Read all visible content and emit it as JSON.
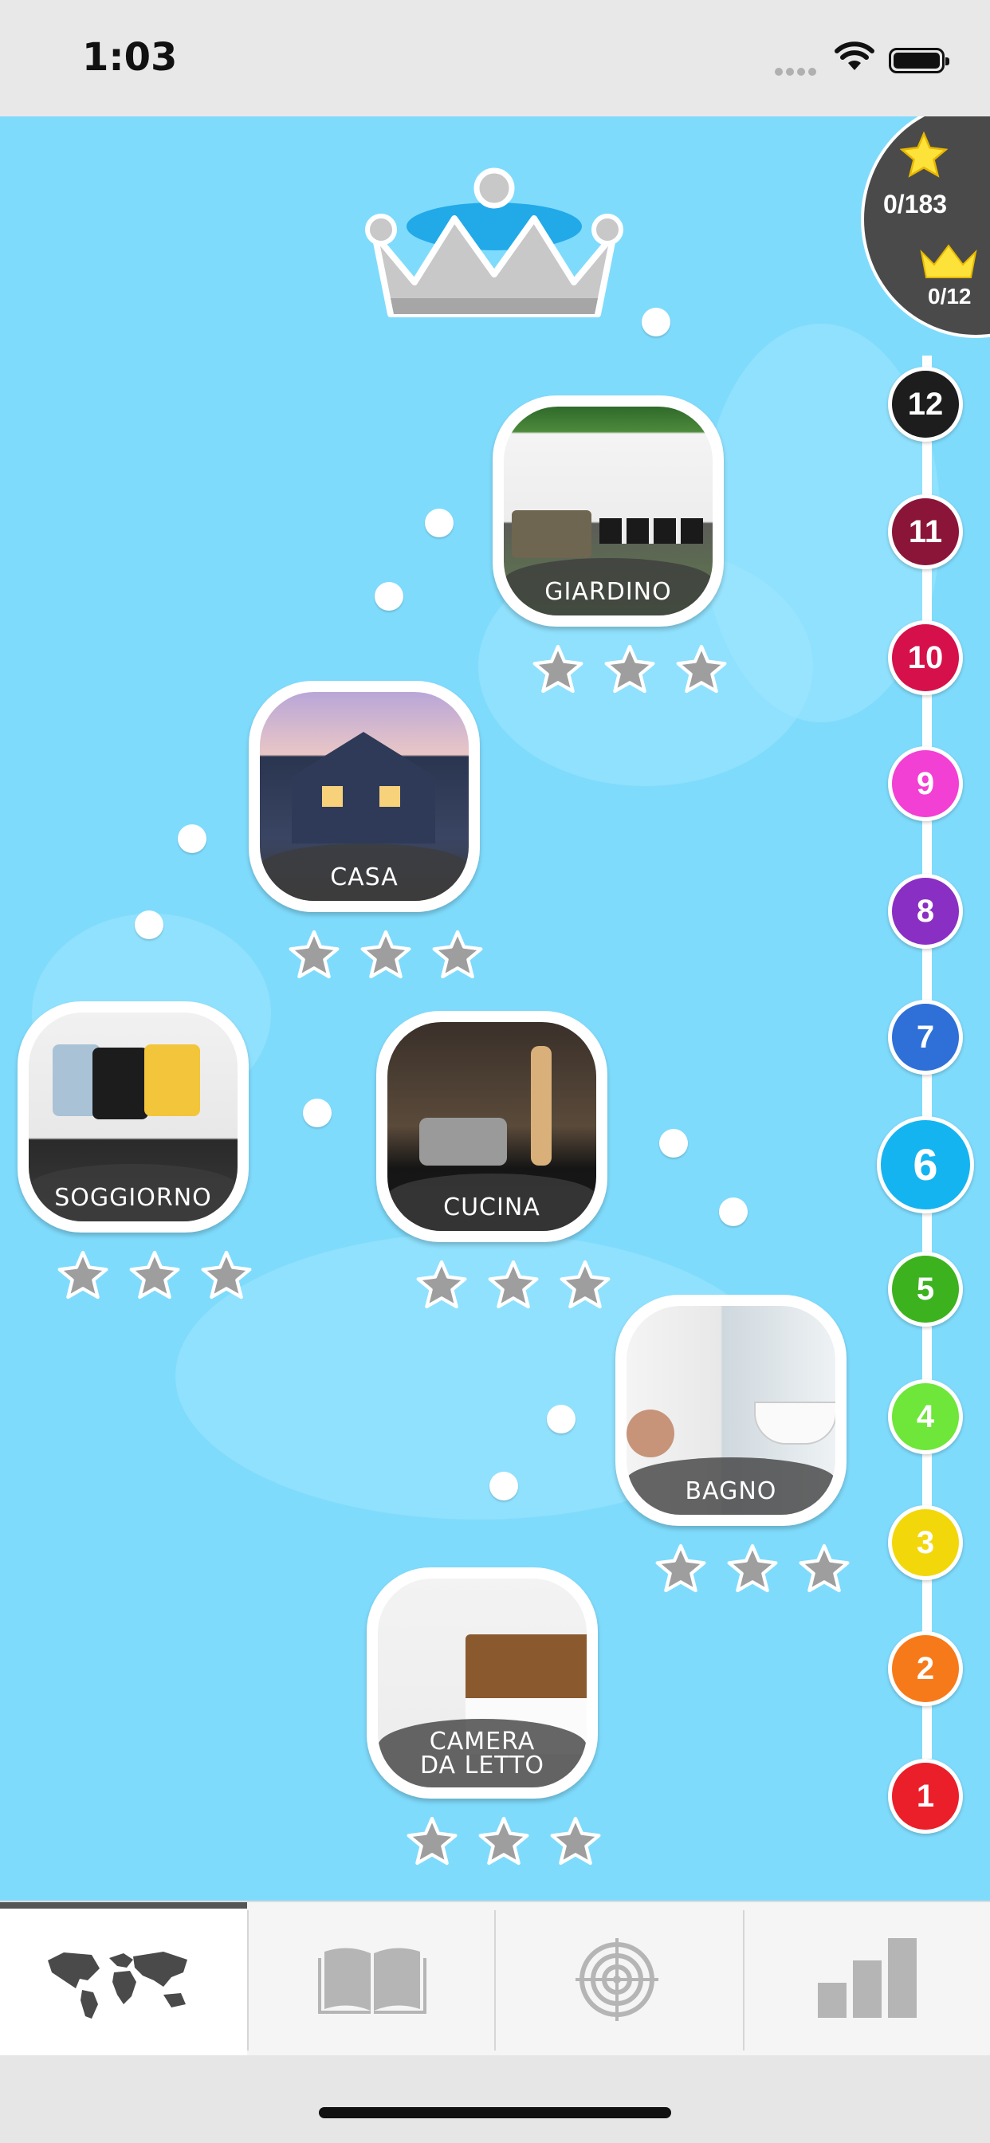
{
  "status_bar": {
    "time": "1:03"
  },
  "progress": {
    "stars": "0/183",
    "crowns": "0/12"
  },
  "levels": [
    {
      "label": "GIARDINO",
      "stars_earned": 0,
      "stars_total": 3
    },
    {
      "label": "CASA",
      "stars_earned": 0,
      "stars_total": 3
    },
    {
      "label": "SOGGIORNO",
      "stars_earned": 0,
      "stars_total": 3
    },
    {
      "label": "CUCINA",
      "stars_earned": 0,
      "stars_total": 3
    },
    {
      "label": "BAGNO",
      "stars_earned": 0,
      "stars_total": 3
    },
    {
      "label": "CAMERA DA LETTO",
      "stars_earned": 0,
      "stars_total": 3
    }
  ],
  "world_numbers": [
    "12",
    "11",
    "10",
    "9",
    "8",
    "7",
    "6",
    "5",
    "4",
    "3",
    "2",
    "1"
  ],
  "selected_world": "6",
  "tabs": [
    {
      "icon": "world-map-icon"
    },
    {
      "icon": "book-icon"
    },
    {
      "icon": "target-icon"
    },
    {
      "icon": "bar-chart-icon"
    }
  ],
  "colors": {
    "background": "#7fdbfc",
    "world_12": "#1d1d1d",
    "world_11": "#8b1538",
    "world_10": "#d6104a",
    "world_9": "#f23fd4",
    "world_8": "#8a2fc4",
    "world_7": "#2f6fd8",
    "world_6": "#14b4f0",
    "world_5": "#3db21f",
    "world_4": "#6ee63a",
    "world_3": "#f2d80a",
    "world_2": "#f77a1a",
    "world_1": "#ea1f2a"
  }
}
